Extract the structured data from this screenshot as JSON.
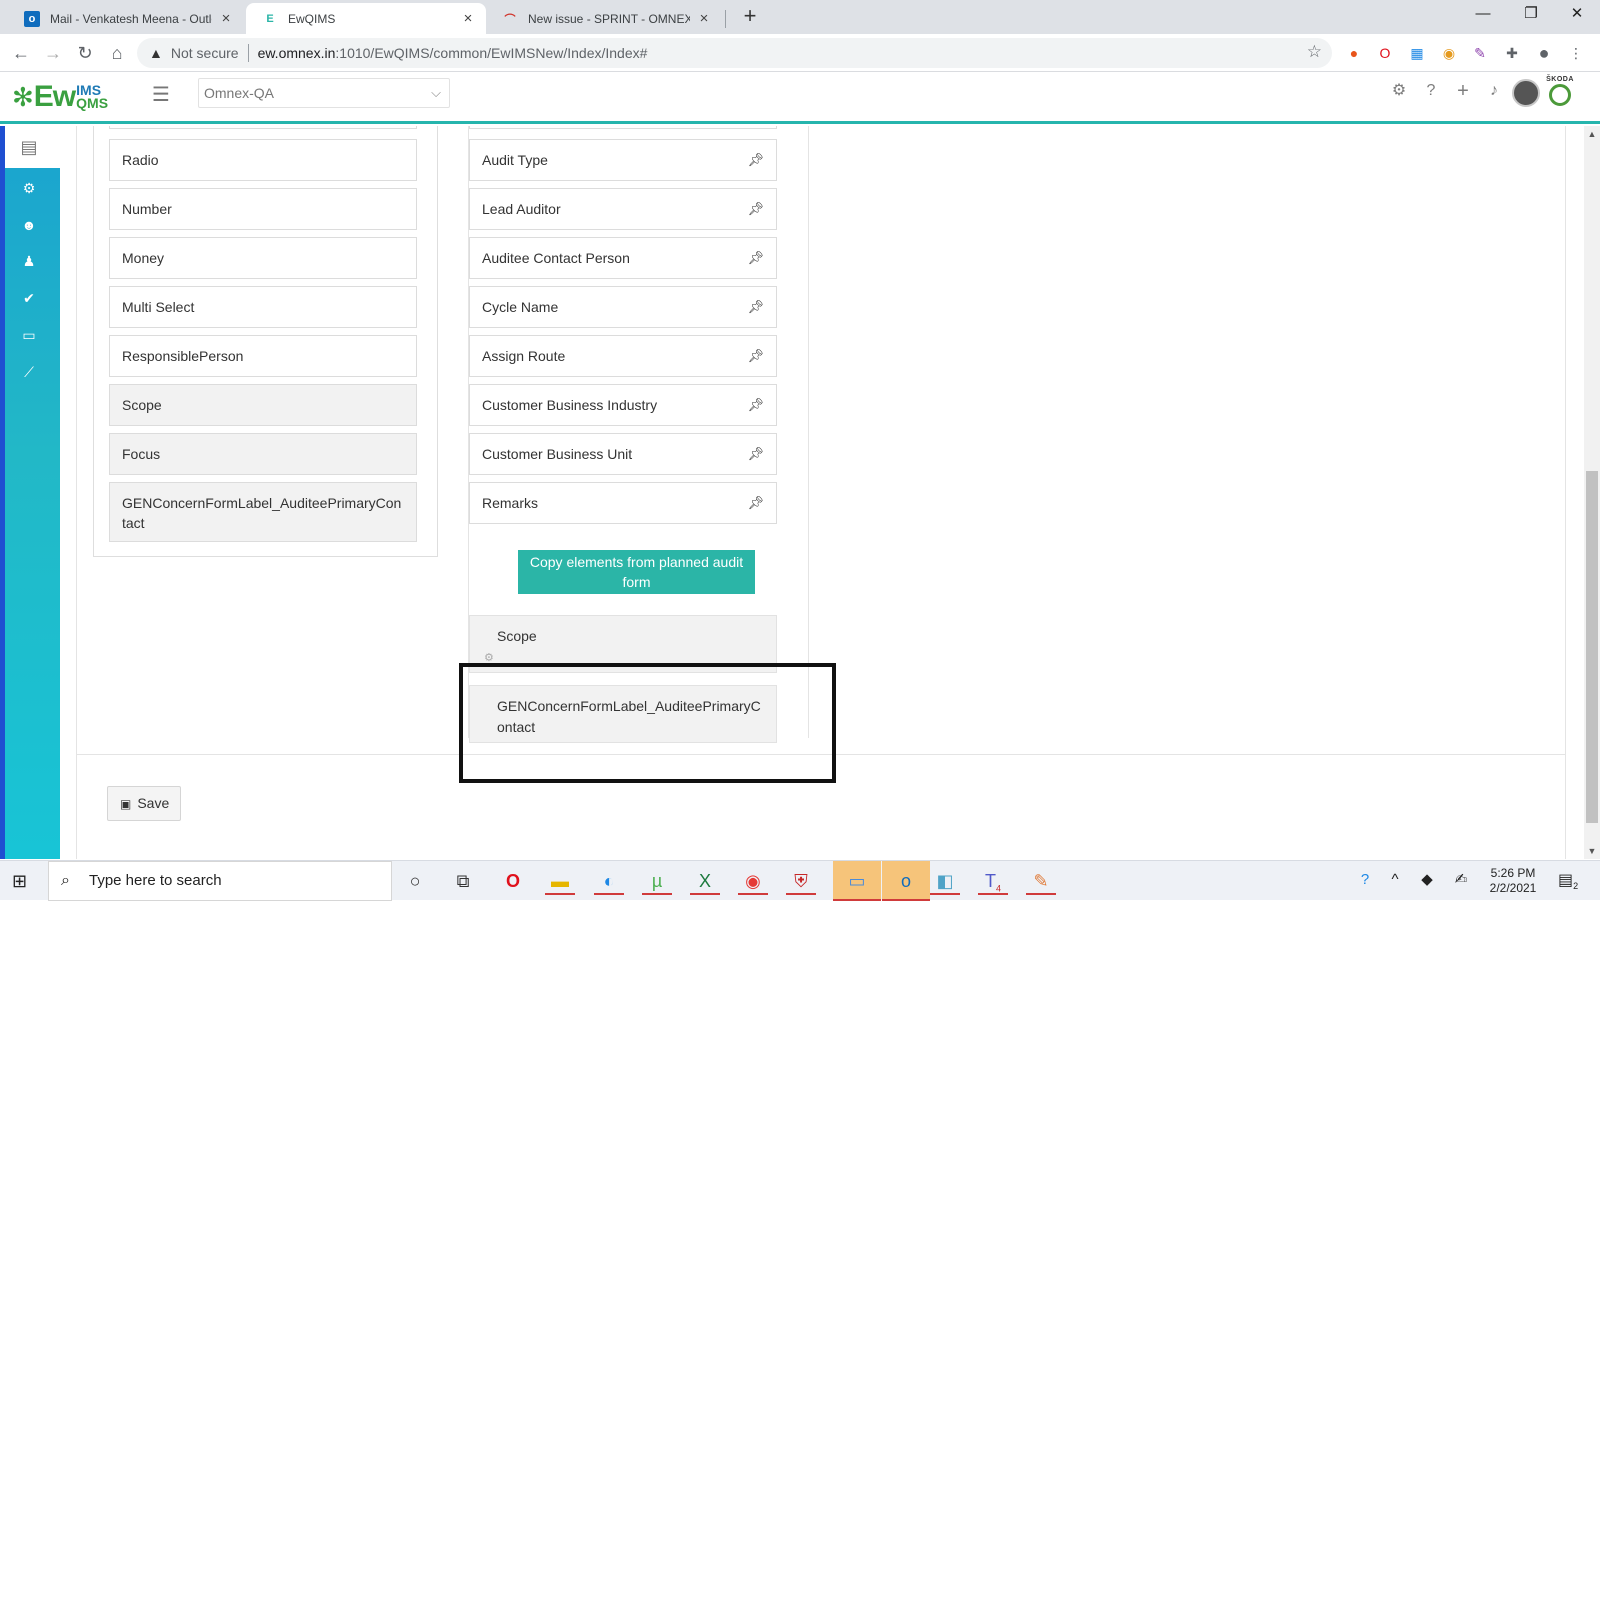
{
  "browser": {
    "tabs": [
      {
        "title": "Mail - Venkatesh Meena - Outlook",
        "icon": "outlook-icon",
        "active": false
      },
      {
        "title": "EwQIMS",
        "icon": "ewqims-icon",
        "active": true
      },
      {
        "title": "New issue - SPRINT - OMNEX ISSUES",
        "icon": "jira-icon",
        "active": false
      }
    ],
    "security_label": "Not secure",
    "url_host": "ew.omnex.in",
    "url_path": ":1010/EwQIMS/common/EwIMSNew/Index/Index#"
  },
  "app": {
    "logo_main": "Ew",
    "logo_top": "IMS",
    "logo_bottom": "QMS",
    "tenant": "Omnex-QA",
    "brand_name": "ŠKODA"
  },
  "left_fields": [
    {
      "label": "Radio",
      "grey": false
    },
    {
      "label": "Number",
      "grey": false
    },
    {
      "label": "Money",
      "grey": false
    },
    {
      "label": "Multi Select",
      "grey": false
    },
    {
      "label": "ResponsiblePerson",
      "grey": false
    },
    {
      "label": "Scope",
      "grey": true
    },
    {
      "label": "Focus",
      "grey": true
    },
    {
      "label": "GENConcernFormLabel_AuditeePrimaryContact",
      "grey": true
    }
  ],
  "pinned_fields": [
    "Audit Type",
    "Lead Auditor",
    "Auditee Contact Person",
    "Cycle Name",
    "Assign Route",
    "Customer Business Industry",
    "Customer Business Unit",
    "Remarks"
  ],
  "copy_button_label": "Copy elements from planned audit form",
  "dropped_fields": [
    "Scope",
    "GENConcernFormLabel_AuditeePrimaryContact"
  ],
  "save_label": "Save",
  "taskbar": {
    "search_placeholder": "Type here to search",
    "time": "5:26 PM",
    "date": "2/2/2021",
    "notification_count": "2",
    "teams_badge": "4"
  },
  "colors": {
    "accent": "#2bb5a7",
    "sidebar_top": "#1aa3cf",
    "sidebar_bottom": "#18c4d6",
    "logo_green": "#3aa040"
  }
}
